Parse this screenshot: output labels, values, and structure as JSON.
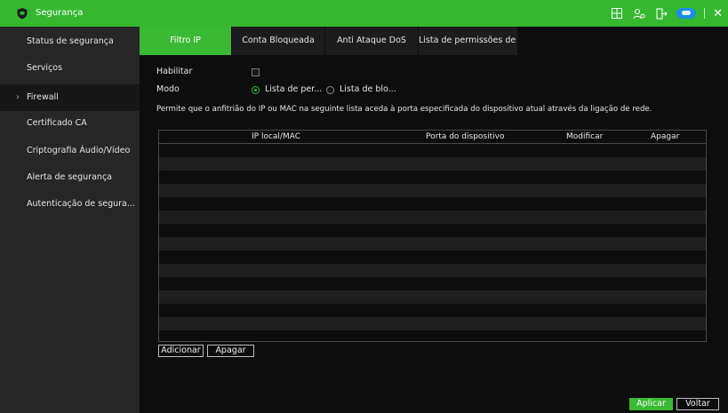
{
  "window": {
    "title": "Segurança"
  },
  "topbar_icons": [
    "fab-icon",
    "user-switch-icon",
    "logout-icon",
    "cloud-icon",
    "close-icon"
  ],
  "sidebar": {
    "items": [
      {
        "label": "Status de segurança"
      },
      {
        "label": "Serviços"
      },
      {
        "label": "Firewall",
        "active": true
      },
      {
        "label": "Certificado CA"
      },
      {
        "label": "Criptografia Áudio/Vídeo"
      },
      {
        "label": "Alerta de segurança"
      },
      {
        "label": "Autenticação de segura..."
      }
    ]
  },
  "tabs": [
    {
      "label": "Filtro IP",
      "active": true
    },
    {
      "label": "Conta Bloqueada"
    },
    {
      "label": "Anti Ataque DoS"
    },
    {
      "label": "Lista de permissões de ..."
    }
  ],
  "form": {
    "enable_label": "Habilitar",
    "enable_checked": false,
    "mode_label": "Modo",
    "mode_options": [
      {
        "label": "Lista de per...",
        "selected": true
      },
      {
        "label": "Lista de blo...",
        "selected": false
      }
    ],
    "description": "Permite que o anfitrião do IP ou MAC na seguinte lista aceda à porta especificada do dispositivo atual através da ligação de rede."
  },
  "table": {
    "columns": [
      "IP local/MAC",
      "Porta do dispositivo",
      "Modificar",
      "Apagar"
    ],
    "rows": []
  },
  "buttons": {
    "add": "Adicionar",
    "delete": "Apagar",
    "apply": "Aplicar",
    "back": "Voltar"
  },
  "colors": {
    "accent": "#35b830",
    "sidebar_bg": "#262626",
    "main_bg": "#0d0d0d"
  }
}
